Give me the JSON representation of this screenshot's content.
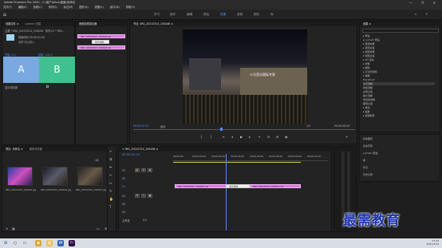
{
  "titlebar": {
    "title": "Adobe Premiere Pro 2020 - C:\\用户\\Alice\\桌面\\未命名",
    "window_controls": "— ❐ ✕"
  },
  "menubar": {
    "items": [
      "文件(F)",
      "编辑(E)",
      "剪辑(C)",
      "序列(S)",
      "标记(M)",
      "图形(G)",
      "视图(V)",
      "窗口(W)",
      "帮助(H)"
    ]
  },
  "workspaces": {
    "items": [
      "学习",
      "组件",
      "编辑",
      "颜色",
      "效果",
      "音频",
      "图形",
      "库"
    ],
    "active": "效果"
  },
  "effect_controls": {
    "tabs": [
      "效果控件 ≡",
      "Lumetri 范围",
      "源:(无剪辑)",
      "音频剪辑混合器"
    ],
    "row1": "主要 * IMG_20210314_100446 · 序列 01 * IMG...",
    "row2": "视频",
    "row3": "▸ fx 运动",
    "row_left": "渐变擦除",
    "row_time": "00:00:02:02",
    "row_dur": "持续时间 00:00:01:00",
    "row_align": "对齐 中心切入",
    "row_start": "开始: 0.0",
    "row_end": "结束: 100.0",
    "show_source": "显示实际源",
    "reverse": "反向",
    "border_width": "边框宽度",
    "letter_a": "A",
    "letter_b": "B"
  },
  "mini_timeline": {
    "clip_top": "IMG_20210314_100446.jpg",
    "transition": "渐变擦除",
    "clip_bottom": "IMG_20210314_100446.jpg"
  },
  "program_monitor": {
    "tabs": [
      "节目: IMG_20210314_100446 ≡"
    ],
    "timecode_left": "00:00:02:10",
    "fit": "适合",
    "zoom": "1/2",
    "timecode_right": "00:00:06:00",
    "sign_text": "小马音乐国际专家"
  },
  "project": {
    "tabs": [
      "项目: 未命名 ≡",
      "媒体浏览器"
    ],
    "items": [
      {
        "name": "IMG_20210314_100446.jpg",
        "duration": "5:00"
      },
      {
        "name": "IMG_20210314_100510.jpg",
        "duration": "5:00"
      },
      {
        "name": "IMG_20210314_100522.jpg",
        "duration": "5:00"
      }
    ],
    "count": "3项"
  },
  "timeline": {
    "tabs": [
      "× IMG_20210314_100446 ≡"
    ],
    "timecode": "00:00:02:10",
    "ruler": [
      "00:00:00",
      "00:00:01:00",
      "00:00:02:00",
      "00:00:03:00",
      "00:00:04:00",
      "00:00:05:00",
      "00:00:06:00",
      "00:00:07:00"
    ],
    "tracks": [
      "V3",
      "V2",
      "V1",
      "A1",
      "A2",
      "A3",
      "主声道"
    ],
    "master_value": "0.0",
    "clip_a": "IMG_20210314_100446.jpg",
    "clip_transition": "渐变擦除",
    "clip_b": "IMG_20210314_100510.jpg"
  },
  "effects_panel": {
    "title": "效果 ≡",
    "tree": [
      "▸ 预设",
      "▸ Lumetri 预设",
      "▸ 音频效果",
      "▸ 音频过渡",
      "▸ 视频效果",
      "▾ 视频过渡",
      "  ▸ 3D 运动",
      "  ▸ 划像",
      "  ▸ 擦除",
      "  ▸ 沉浸式视频",
      "  ▾ 溶解",
      "     MorphCut",
      "     交叉溶解",
      "     叠加溶解",
      "     白场过渡",
      "     胶片溶解",
      "     非叠加溶解",
      "     黑场过渡",
      "  ▸ 滑动",
      "  ▸ 缩放",
      "  ▸ 页面剥落"
    ],
    "highlight_index": 12
  },
  "essential_sound": {
    "items": [
      "基本图形",
      "基本声音",
      "Lumetri 颜色",
      "库",
      "标记",
      "历史记录",
      "信息"
    ]
  },
  "watermark": {
    "text": "最需教育"
  },
  "taskbar": {
    "time": "17:32",
    "date": "2021/3/15"
  },
  "colors": {
    "accent": "#4f8ff5",
    "clip": "#d77be0",
    "panel": "#232323"
  }
}
